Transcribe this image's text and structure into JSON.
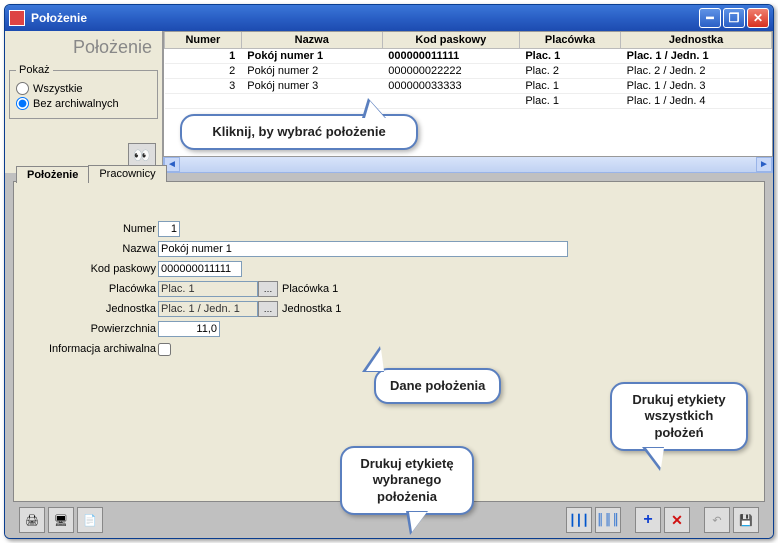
{
  "window": {
    "title": "Położenie"
  },
  "left": {
    "title": "Położenie",
    "pokaz_legend": "Pokaż",
    "radio_all": "Wszystkie",
    "radio_noarch": "Bez archiwalnych"
  },
  "table": {
    "headers": {
      "numer": "Numer",
      "nazwa": "Nazwa",
      "kod": "Kod paskowy",
      "plac": "Placówka",
      "jedn": "Jednostka"
    },
    "rows": [
      {
        "numer": "1",
        "nazwa": "Pokój numer 1",
        "kod": "000000011111",
        "plac": "Plac. 1",
        "jedn": "Plac. 1 / Jedn. 1"
      },
      {
        "numer": "2",
        "nazwa": "Pokój numer 2",
        "kod": "000000022222",
        "plac": "Plac. 2",
        "jedn": "Plac. 2 / Jedn. 2"
      },
      {
        "numer": "3",
        "nazwa": "Pokój numer 3",
        "kod": "000000033333",
        "plac": "Plac. 1",
        "jedn": "Plac. 1 / Jedn. 3"
      },
      {
        "numer": "",
        "nazwa": "",
        "kod": "",
        "plac": "Plac. 1",
        "jedn": "Plac. 1 / Jedn. 4"
      }
    ]
  },
  "tabs": {
    "polozenie": "Położenie",
    "pracownicy": "Pracownicy"
  },
  "form": {
    "labels": {
      "numer": "Numer",
      "nazwa": "Nazwa",
      "kod": "Kod paskowy",
      "placowka": "Placówka",
      "jednostka": "Jednostka",
      "pow": "Powierzchnia",
      "arch": "Informacja archiwalna"
    },
    "values": {
      "numer": "1",
      "nazwa": "Pokój numer 1",
      "kod": "000000011111",
      "placowka": "Plac. 1",
      "jednostka": "Plac. 1 / Jedn. 1",
      "pow": "11,0"
    },
    "captions": {
      "placowka": "Placówka 1",
      "jednostka": "Jednostka 1"
    }
  },
  "callouts": {
    "c1": "Kliknij, by wybrać położenie",
    "c2": "Dane położenia",
    "c3": "Drukuj etykietę wybranego położenia",
    "c4": "Drukuj etykiety wszystkich położeń"
  }
}
